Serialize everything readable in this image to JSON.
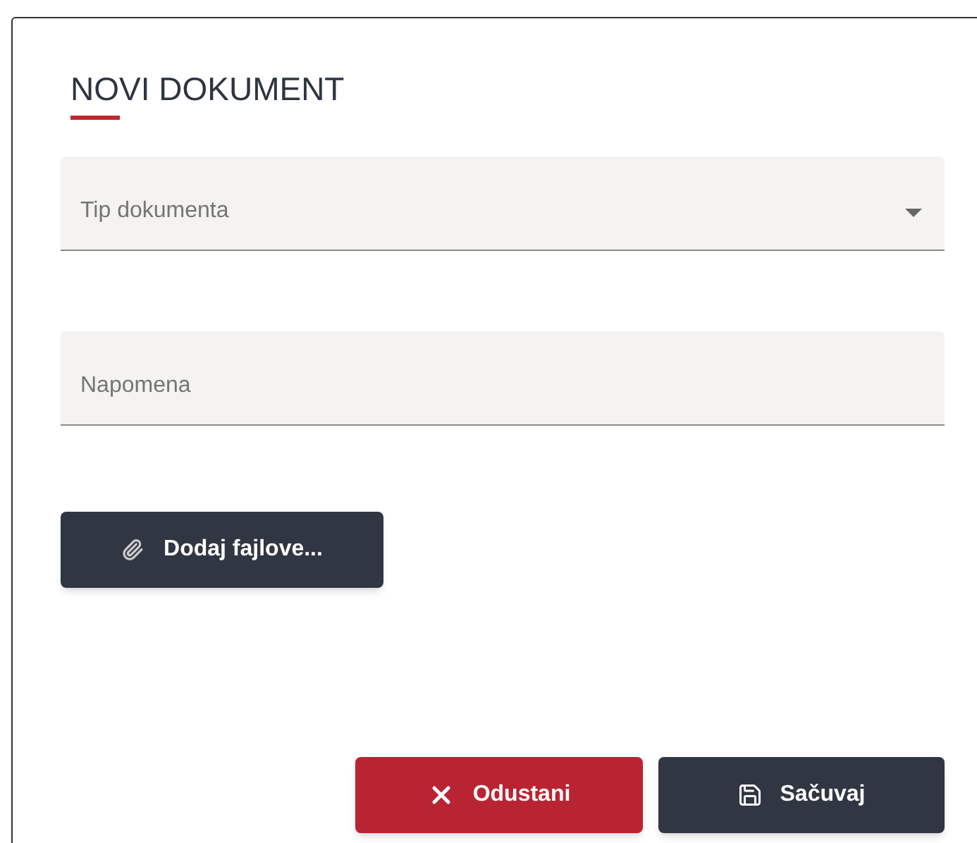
{
  "dialog": {
    "title": "NOVI DOKUMENT"
  },
  "fields": [
    {
      "kind": "select",
      "placeholder": "Tip dokumenta"
    },
    {
      "kind": "text",
      "placeholder": "Napomena"
    }
  ],
  "attach_button": {
    "label": "Dodaj fajlove..."
  },
  "buttons": [
    {
      "kind": "cancel",
      "label": "Odustani"
    },
    {
      "kind": "save",
      "label": "Sačuvaj"
    }
  ]
}
